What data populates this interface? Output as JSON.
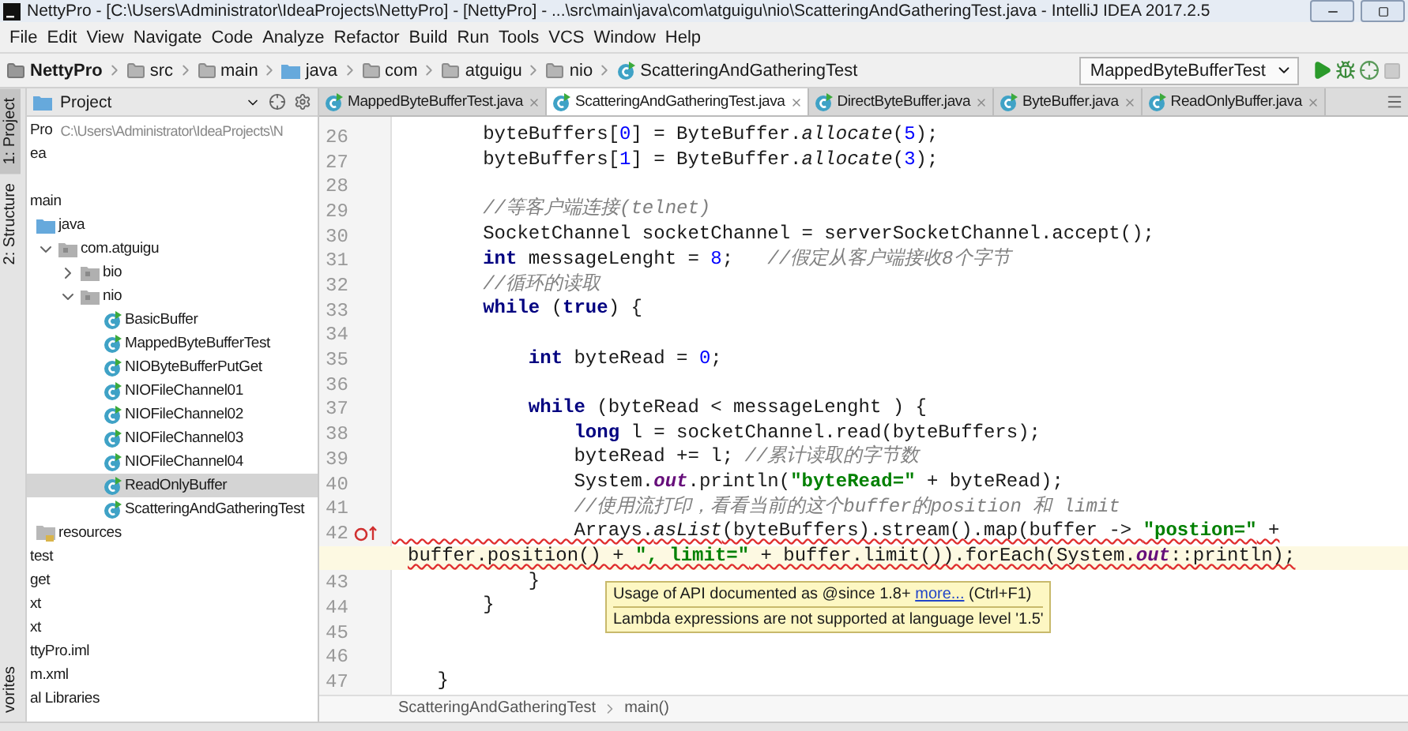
{
  "window": {
    "title": "NettyPro - [C:\\Users\\Administrator\\IdeaProjects\\NettyPro] - [NettyPro] - ...\\src\\main\\java\\com\\atguigu\\nio\\ScatteringAndGatheringTest.java - IntelliJ IDEA 2017.2.5"
  },
  "menu": [
    "File",
    "Edit",
    "View",
    "Navigate",
    "Code",
    "Analyze",
    "Refactor",
    "Build",
    "Run",
    "Tools",
    "VCS",
    "Window",
    "Help"
  ],
  "nav_bar": {
    "crumbs": [
      {
        "label": "NettyPro",
        "kind": "project"
      },
      {
        "label": "src",
        "kind": "folder"
      },
      {
        "label": "main",
        "kind": "folder"
      },
      {
        "label": "java",
        "kind": "source-folder"
      },
      {
        "label": "com",
        "kind": "folder"
      },
      {
        "label": "atguigu",
        "kind": "folder"
      },
      {
        "label": "nio",
        "kind": "folder"
      },
      {
        "label": "ScatteringAndGatheringTest",
        "kind": "class"
      }
    ],
    "run_config": "MappedByteBufferTest"
  },
  "tool_strip": {
    "top": [
      {
        "label": "1: Project",
        "selected": true
      },
      {
        "label": "2: Structure",
        "selected": false
      }
    ],
    "bottom": [
      {
        "label": "vorites",
        "selected": false
      }
    ]
  },
  "project_panel": {
    "title": "Project",
    "tree": [
      {
        "label": "Pro",
        "path": "C:\\Users\\Administrator\\IdeaProjects\\N",
        "selected": false
      },
      {
        "label": "ea",
        "selected": false
      },
      {
        "label": "main",
        "selected": false,
        "children": [
          {
            "label": "java",
            "kind": "source-folder",
            "selected": false,
            "children": [
              {
                "label": "com.atguigu",
                "kind": "package",
                "expanded": true,
                "selected": false,
                "children": [
                  {
                    "label": "bio",
                    "kind": "package",
                    "expanded": false,
                    "selected": false
                  },
                  {
                    "label": "nio",
                    "kind": "package",
                    "expanded": true,
                    "selected": false,
                    "children": [
                      {
                        "label": "BasicBuffer",
                        "kind": "class",
                        "selected": false
                      },
                      {
                        "label": "MappedByteBufferTest",
                        "kind": "class",
                        "selected": false
                      },
                      {
                        "label": "NIOByteBufferPutGet",
                        "kind": "class",
                        "selected": false
                      },
                      {
                        "label": "NIOFileChannel01",
                        "kind": "class",
                        "selected": false
                      },
                      {
                        "label": "NIOFileChannel02",
                        "kind": "class",
                        "selected": false
                      },
                      {
                        "label": "NIOFileChannel03",
                        "kind": "class",
                        "selected": false
                      },
                      {
                        "label": "NIOFileChannel04",
                        "kind": "class",
                        "selected": false
                      },
                      {
                        "label": "ReadOnlyBuffer",
                        "kind": "class",
                        "selected": true
                      },
                      {
                        "label": "ScatteringAndGatheringTest",
                        "kind": "class",
                        "selected": false
                      }
                    ]
                  }
                ]
              }
            ]
          },
          {
            "label": "resources",
            "kind": "resources-folder",
            "selected": false
          }
        ]
      },
      {
        "label": "test",
        "selected": false
      },
      {
        "label": "get",
        "selected": false
      },
      {
        "label": "xt",
        "selected": false
      },
      {
        "label": "xt",
        "selected": false
      },
      {
        "label": "ttyPro.iml",
        "selected": false
      },
      {
        "label": "m.xml",
        "selected": false
      },
      {
        "label": "al Libraries",
        "selected": false
      }
    ]
  },
  "editor": {
    "tabs": [
      {
        "label": "MappedByteBufferTest.java",
        "selected": false
      },
      {
        "label": "ScatteringAndGatheringTest.java",
        "selected": true
      },
      {
        "label": "DirectByteBuffer.java",
        "selected": false
      },
      {
        "label": "ByteBuffer.java",
        "selected": false
      },
      {
        "label": "ReadOnlyBuffer.java",
        "selected": false
      }
    ],
    "lines": [
      {
        "number": "26",
        "kind": "plain",
        "caret": false,
        "error": false,
        "tokens": [
          {
            "kind": "plain",
            "text": "        byteBuffers["
          },
          {
            "kind": "number",
            "text": "0"
          },
          {
            "kind": "plain",
            "text": "] = ByteBuffer."
          },
          {
            "kind": "static",
            "text": "allocate"
          },
          {
            "kind": "plain",
            "text": "("
          },
          {
            "kind": "number",
            "text": "5"
          },
          {
            "kind": "plain",
            "text": ");"
          }
        ]
      },
      {
        "number": "27",
        "kind": "plain",
        "caret": false,
        "error": false,
        "tokens": [
          {
            "kind": "plain",
            "text": "        byteBuffers["
          },
          {
            "kind": "number",
            "text": "1"
          },
          {
            "kind": "plain",
            "text": "] = ByteBuffer."
          },
          {
            "kind": "static",
            "text": "allocate"
          },
          {
            "kind": "plain",
            "text": "("
          },
          {
            "kind": "number",
            "text": "3"
          },
          {
            "kind": "plain",
            "text": ");"
          }
        ]
      },
      {
        "number": "28",
        "kind": "plain",
        "caret": false
      },
      {
        "number": "29",
        "kind": "plain",
        "caret": false,
        "error": false,
        "tokens": [
          {
            "kind": "comment",
            "text": "        //等客户端连接(telnet)"
          }
        ]
      },
      {
        "number": "30",
        "kind": "plain",
        "caret": false,
        "error": false,
        "tokens": [
          {
            "kind": "plain",
            "text": "        SocketChannel socketChannel = serverSocketChannel.accept();"
          }
        ]
      },
      {
        "number": "31",
        "kind": "plain",
        "caret": false,
        "error": false,
        "tokens": [
          {
            "kind": "keyword",
            "text": "        int"
          },
          {
            "kind": "plain",
            "text": " messageLenght = "
          },
          {
            "kind": "number",
            "text": "8"
          },
          {
            "kind": "plain",
            "text": ";   "
          },
          {
            "kind": "comment",
            "text": "//假定从客户端接收8个字节"
          }
        ]
      },
      {
        "number": "32",
        "kind": "plain",
        "caret": false,
        "error": false,
        "tokens": [
          {
            "kind": "comment",
            "text": "        //循环的读取"
          }
        ]
      },
      {
        "number": "33",
        "kind": "plain",
        "caret": false,
        "error": false,
        "tokens": [
          {
            "kind": "keyword",
            "text": "        while"
          },
          {
            "kind": "plain",
            "text": " ("
          },
          {
            "kind": "keyword",
            "text": "true"
          },
          {
            "kind": "plain",
            "text": ") {"
          }
        ]
      },
      {
        "number": "34",
        "kind": "plain",
        "caret": false
      },
      {
        "number": "35",
        "kind": "plain",
        "caret": false,
        "error": false,
        "tokens": [
          {
            "kind": "keyword",
            "text": "            int"
          },
          {
            "kind": "plain",
            "text": " byteRead = "
          },
          {
            "kind": "number",
            "text": "0"
          },
          {
            "kind": "plain",
            "text": ";"
          }
        ]
      },
      {
        "number": "36",
        "kind": "plain",
        "caret": false
      },
      {
        "number": "37",
        "kind": "plain",
        "caret": false,
        "error": false,
        "tokens": [
          {
            "kind": "keyword",
            "text": "            while"
          },
          {
            "kind": "plain",
            "text": " (byteRead < messageLenght ) {"
          }
        ]
      },
      {
        "number": "38",
        "kind": "plain",
        "caret": false,
        "error": false,
        "tokens": [
          {
            "kind": "keyword",
            "text": "                long"
          },
          {
            "kind": "plain",
            "text": " l = socketChannel.read(byteBuffers);"
          }
        ]
      },
      {
        "number": "39",
        "kind": "plain",
        "caret": false,
        "error": false,
        "tokens": [
          {
            "kind": "plain",
            "text": "                byteRead += l; "
          },
          {
            "kind": "comment",
            "text": "//累计读取的字节数"
          }
        ]
      },
      {
        "number": "40",
        "kind": "plain",
        "caret": false,
        "error": false,
        "tokens": [
          {
            "kind": "plain",
            "text": "                System."
          },
          {
            "kind": "field",
            "text": "out"
          },
          {
            "kind": "plain",
            "text": ".println("
          },
          {
            "kind": "string",
            "text": "\"byteRead=\""
          },
          {
            "kind": "plain",
            "text": " + byteRead);"
          }
        ]
      },
      {
        "number": "41",
        "kind": "plain",
        "caret": false,
        "error": false,
        "tokens": [
          {
            "kind": "comment",
            "text": "                //使用流打印，看看当前的这个buffer的position 和 limit"
          }
        ]
      },
      {
        "number": "42",
        "kind": "marked",
        "caret": false,
        "error": true,
        "tokens": [
          {
            "kind": "plain",
            "text": "                Arrays."
          },
          {
            "kind": "static",
            "text": "asList"
          },
          {
            "kind": "plain",
            "text": "(byteBuffers).stream().map(buffer -> "
          },
          {
            "kind": "string",
            "text": "\"postion=\""
          },
          {
            "kind": "plain",
            "text": " +"
          }
        ]
      },
      {
        "kind": "wrap",
        "caret": true,
        "error": true,
        "tokens": [
          {
            "kind": "plain",
            "text": "buffer.position() + "
          },
          {
            "kind": "string",
            "text": "\", limit=\""
          },
          {
            "kind": "plain",
            "text": " + buffer.limit()).forEach(System."
          },
          {
            "kind": "field",
            "text": "out"
          },
          {
            "kind": "plain",
            "text": "::println);"
          }
        ]
      },
      {
        "number": "43",
        "kind": "plain",
        "caret": false,
        "error": false,
        "tokens": [
          {
            "kind": "plain",
            "text": "            }"
          }
        ]
      },
      {
        "number": "44",
        "kind": "plain",
        "caret": false,
        "error": false,
        "tokens": [
          {
            "kind": "plain",
            "text": "        }"
          }
        ]
      },
      {
        "number": "45",
        "kind": "plain",
        "caret": false
      },
      {
        "number": "46",
        "kind": "plain",
        "caret": false
      },
      {
        "number": "47",
        "kind": "plain",
        "caret": false,
        "error": false,
        "tokens": [
          {
            "kind": "plain",
            "text": "    }"
          }
        ]
      }
    ],
    "tooltip": {
      "text": "Usage of API documented as @since 1.8+",
      "link": "more...",
      "shortcut": "(Ctrl+F1)",
      "detail": "Lambda expressions are not supported at language level '1.5'"
    },
    "breadcrumb": [
      "ScatteringAndGatheringTest",
      "main()"
    ]
  }
}
